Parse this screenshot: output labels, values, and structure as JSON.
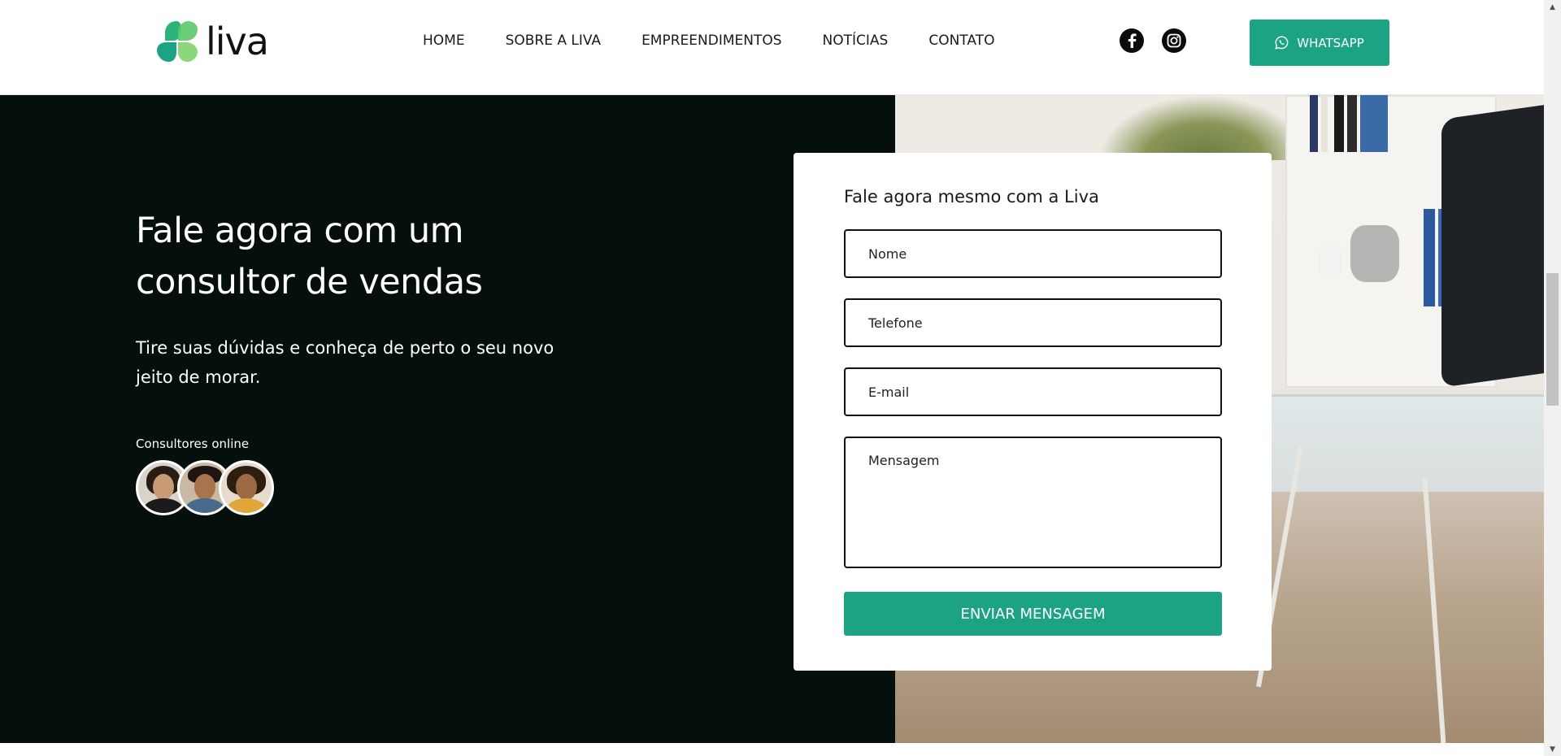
{
  "brand": {
    "logo_text": "liva",
    "accent": "#1ca383",
    "dark_bg": "#050f0c"
  },
  "nav": {
    "items": [
      {
        "label": "HOME"
      },
      {
        "label": "SOBRE A LIVA"
      },
      {
        "label": "EMPREENDIMENTOS"
      },
      {
        "label": "NOTÍCIAS"
      },
      {
        "label": "CONTATO"
      }
    ],
    "social": [
      "facebook-icon",
      "instagram-icon"
    ],
    "whatsapp_label": "WHATSAPP"
  },
  "hero": {
    "title": "Fale agora com um consultor de vendas",
    "subtitle": "Tire suas dúvidas e conheça de perto o seu novo jeito de morar.",
    "consultants_label": "Consultores online"
  },
  "form": {
    "title": "Fale agora mesmo com a Liva",
    "name_placeholder": "Nome",
    "phone_placeholder": "Telefone",
    "email_placeholder": "E-mail",
    "message_placeholder": "Mensagem",
    "submit_label": "ENVIAR MENSAGEM"
  }
}
